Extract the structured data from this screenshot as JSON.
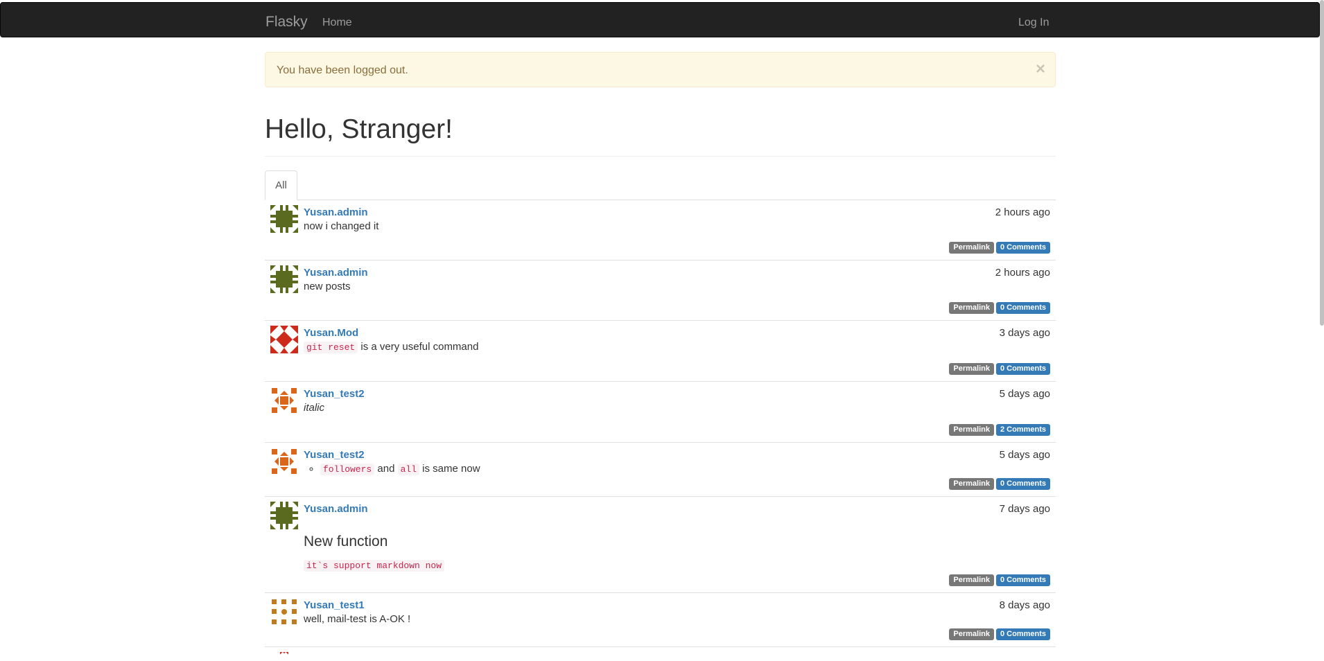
{
  "navbar": {
    "brand": "Flasky",
    "home": "Home",
    "login": "Log In"
  },
  "alert": {
    "message": "You have been logged out.",
    "close": "×"
  },
  "page": {
    "title": "Hello, Stranger!"
  },
  "tabs": {
    "all": "All"
  },
  "labels": {
    "permalink": "Permalink"
  },
  "posts": [
    {
      "author": "Yusan.admin",
      "date": "2 hours ago",
      "body": "now i changed it",
      "comments": "0 Comments",
      "avatar_color": "#5a6b1f"
    },
    {
      "author": "Yusan.admin",
      "date": "2 hours ago",
      "body": "new posts",
      "comments": "0 Comments",
      "avatar_color": "#5a6b1f"
    },
    {
      "author": "Yusan.Mod",
      "date": "3 days ago",
      "code": "git reset",
      "body_after": " is a very useful command",
      "comments": "0 Comments",
      "avatar_color": "#cc2a1a"
    },
    {
      "author": "Yusan_test2",
      "date": "5 days ago",
      "body_italic": "italic",
      "comments": "2 Comments",
      "avatar_color": "#d9661a"
    },
    {
      "author": "Yusan_test2",
      "date": "5 days ago",
      "code1": "followers",
      "mid": " and ",
      "code2": "all",
      "tail": " is same now",
      "comments": "0 Comments",
      "avatar_color": "#d9661a"
    },
    {
      "author": "Yusan.admin",
      "date": "7 days ago",
      "heading": "New function",
      "code": "it`s support markdown now",
      "comments": "0 Comments",
      "avatar_color": "#5a6b1f"
    },
    {
      "author": "Yusan_test1",
      "date": "8 days ago",
      "body": "well, mail-test is A-OK !",
      "comments": "0 Comments",
      "avatar_color": "#c27a1f"
    }
  ]
}
